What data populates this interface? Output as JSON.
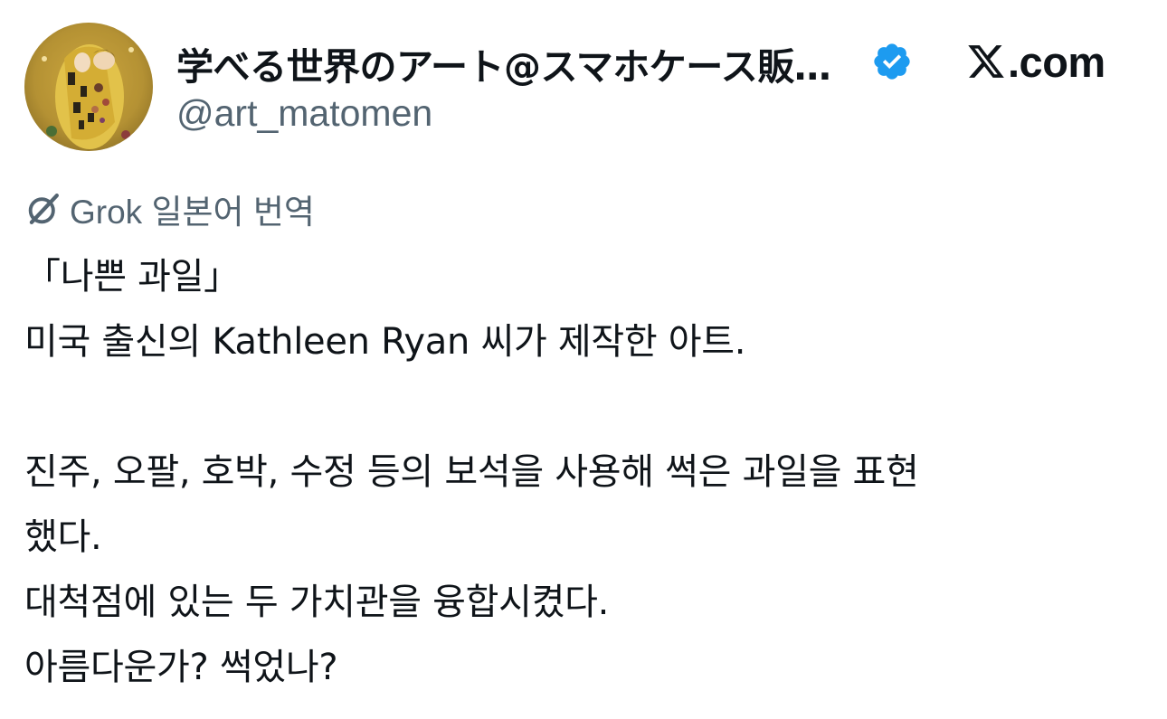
{
  "author": {
    "display_name": "学べる世界のアート@スマホケース販…",
    "handle": "@art_matomen",
    "verified": true,
    "avatar_icon": "painting-avatar"
  },
  "brand": {
    "text": ".com",
    "icon": "x-logo-icon"
  },
  "translation": {
    "icon": "grok-icon",
    "label": "Grok 일본어 번역"
  },
  "tweet": {
    "lines": [
      "「나쁜 과일」",
      "미국 출신의 Kathleen Ryan 씨가 제작한 아트.",
      "",
      "진주, 오팔, 호박, 수정 등의 보석을 사용해 썩은 과일을 표현",
      "했다.",
      "대척점에 있는 두 가치관을 융합시켰다.",
      "아름다운가? 썩었나?"
    ]
  },
  "colors": {
    "text_primary": "#0f1419",
    "text_secondary": "#536471",
    "verified_blue": "#1d9bf0"
  }
}
